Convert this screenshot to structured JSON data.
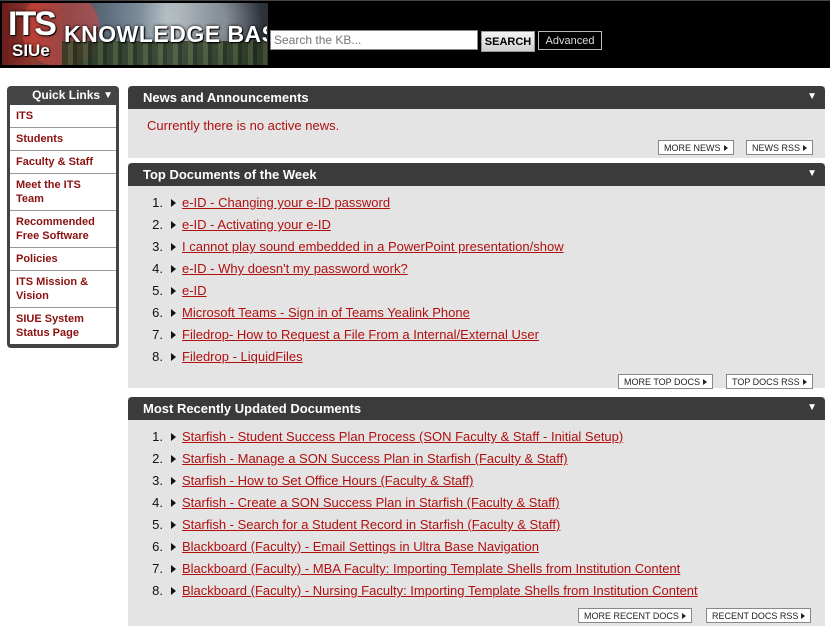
{
  "header": {
    "logo_its": "ITS",
    "logo_siue": "SIUe",
    "logo_title": "KNOWLEDGE BASE",
    "search_placeholder": "Search the KB...",
    "search_button": "SEARCH",
    "advanced_label": "Advanced"
  },
  "sidebar": {
    "title": "Quick Links",
    "items": [
      {
        "label": "ITS"
      },
      {
        "label": "Students"
      },
      {
        "label": "Faculty & Staff"
      },
      {
        "label": "Meet the ITS Team"
      },
      {
        "label": "Recommended Free Software"
      },
      {
        "label": "Policies"
      },
      {
        "label": "ITS Mission & Vision"
      },
      {
        "label": "SIUE System Status Page"
      }
    ]
  },
  "news": {
    "title": "News and Announcements",
    "message": "Currently there is no active news.",
    "more_label": "MORE NEWS",
    "rss_label": "NEWS RSS"
  },
  "top_docs": {
    "title": "Top Documents of the Week",
    "items": [
      {
        "num": "1.",
        "label": "e-ID - Changing your e-ID password"
      },
      {
        "num": "2.",
        "label": "e-ID - Activating your e-ID"
      },
      {
        "num": "3.",
        "label": "I cannot play sound embedded in a PowerPoint presentation/show"
      },
      {
        "num": "4.",
        "label": "e-ID - Why doesn't my password work?"
      },
      {
        "num": "5.",
        "label": "e-ID"
      },
      {
        "num": "6.",
        "label": "Microsoft Teams - Sign in of Teams Yealink Phone"
      },
      {
        "num": "7.",
        "label": "Filedrop- How to Request a File From a Internal/External User"
      },
      {
        "num": "8.",
        "label": "Filedrop - LiquidFiles"
      }
    ],
    "more_label": "MORE TOP DOCS",
    "rss_label": "TOP DOCS RSS"
  },
  "recent_docs": {
    "title": "Most Recently Updated Documents",
    "items": [
      {
        "num": "1.",
        "label": "Starfish - Student Success Plan Process (SON Faculty & Staff - Initial Setup)"
      },
      {
        "num": "2.",
        "label": "Starfish - Manage a SON Success Plan in Starfish (Faculty & Staff)"
      },
      {
        "num": "3.",
        "label": "Starfish - How to Set Office Hours (Faculty & Staff)"
      },
      {
        "num": "4.",
        "label": "Starfish - Create a SON Success Plan in Starfish (Faculty & Staff)"
      },
      {
        "num": "5.",
        "label": "Starfish - Search for a Student Record in Starfish (Faculty & Staff)"
      },
      {
        "num": "6.",
        "label": "Blackboard (Faculty) - Email Settings in Ultra Base Navigation"
      },
      {
        "num": "7.",
        "label": "Blackboard (Faculty) - MBA Faculty: Importing Template Shells from Institution Content"
      },
      {
        "num": "8.",
        "label": "Blackboard (Faculty) - Nursing Faculty: Importing Template Shells from Institution Content"
      }
    ],
    "more_label": "MORE RECENT DOCS",
    "rss_label": "RECENT DOCS RSS"
  },
  "icons": {
    "collapse": "chevron-down-icon",
    "list_bullet": "triangle-right-icon"
  },
  "colors": {
    "link": "#b01010",
    "panel_header": "#3b3b3b",
    "panel_body": "#e4e4e4",
    "header_bg": "#000000"
  }
}
